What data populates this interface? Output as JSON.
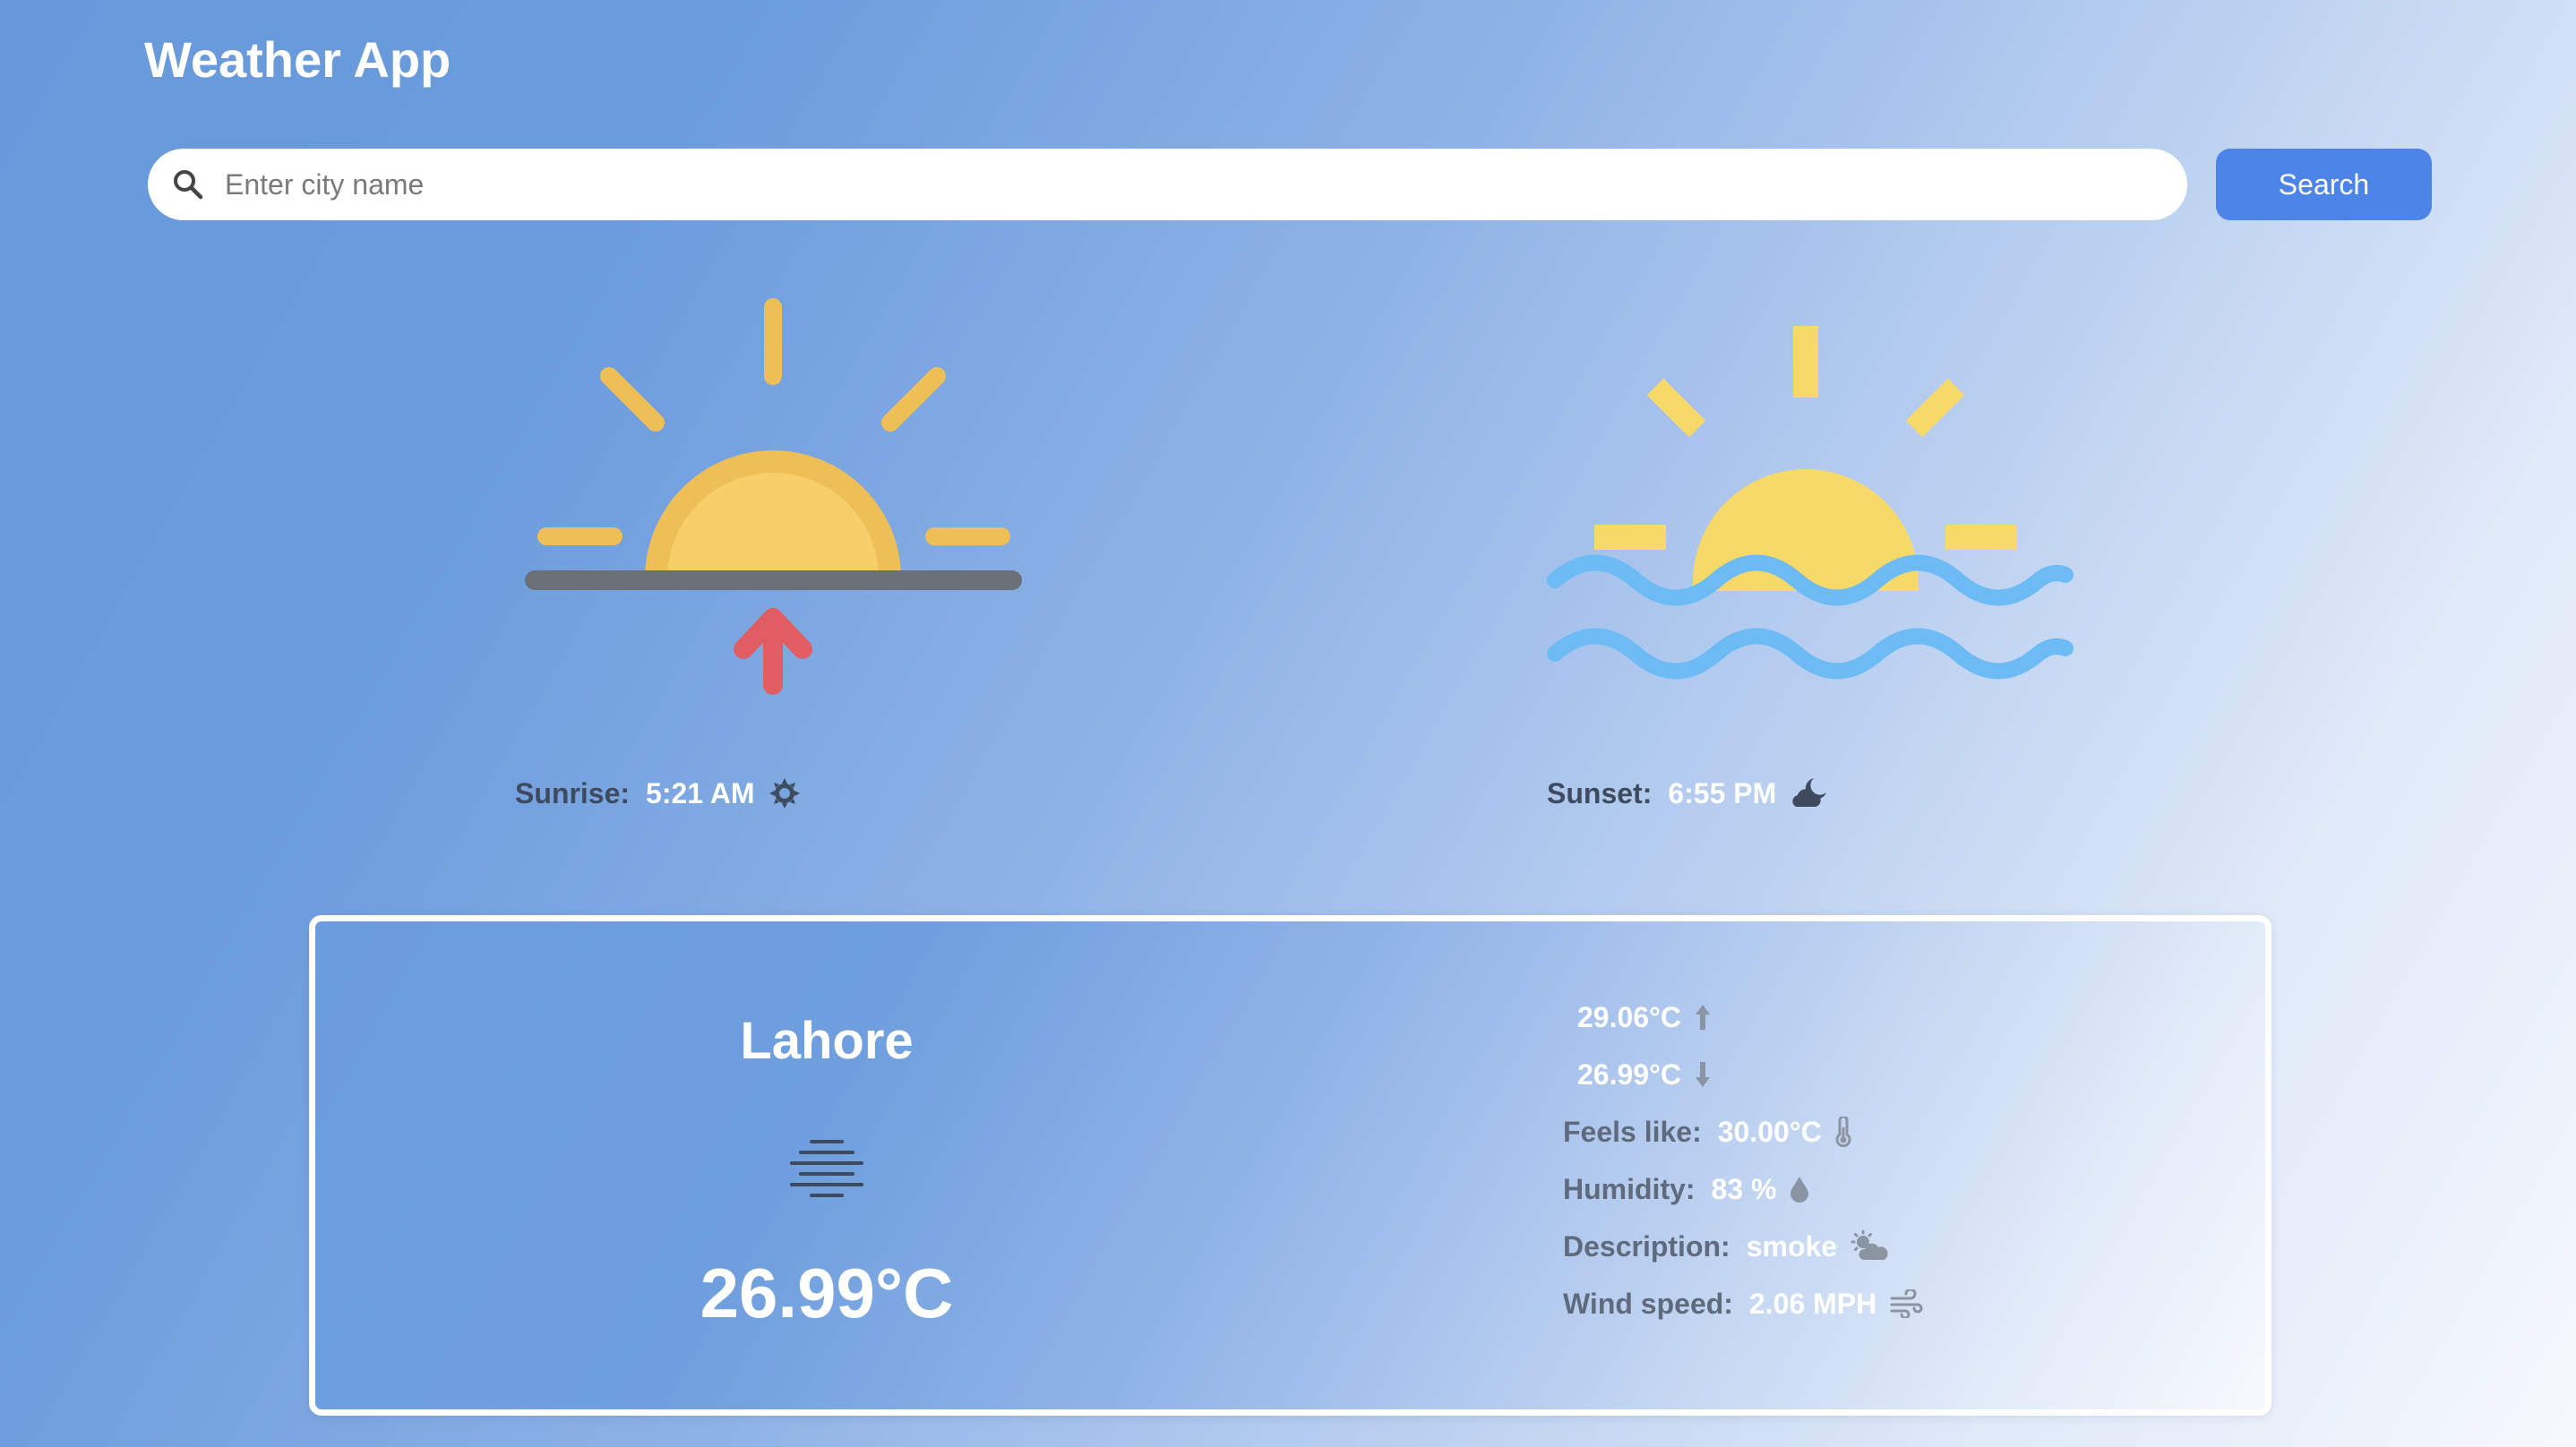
{
  "app": {
    "title": "Weather App"
  },
  "search": {
    "placeholder": "Enter city name",
    "value": "",
    "button_label": "Search"
  },
  "sun": {
    "sunrise_label": "Sunrise:",
    "sunrise_time": "5:21 AM",
    "sunset_label": "Sunset:",
    "sunset_time": "6:55 PM"
  },
  "weather": {
    "city": "Lahore",
    "temperature": "26.99°C",
    "condition_icon": "fog-icon",
    "temp_max": "29.06°C",
    "temp_min": "26.99°C",
    "feels_like_label": "Feels like:",
    "feels_like": "30.00°C",
    "humidity_label": "Humidity:",
    "humidity": "83 %",
    "description_label": "Description:",
    "description": "smoke",
    "wind_label": "Wind speed:",
    "wind_speed": "2.06 MPH"
  },
  "colors": {
    "accent": "#4c84e8",
    "sun_yellow": "#f7cf6a",
    "sun_ring": "#eebf57",
    "horizon": "#6b6f78",
    "arrow_red": "#e25d61",
    "wave_blue": "#6cbbf5",
    "label_text": "#5f6b7d",
    "icon_gray": "#8a94a3"
  }
}
